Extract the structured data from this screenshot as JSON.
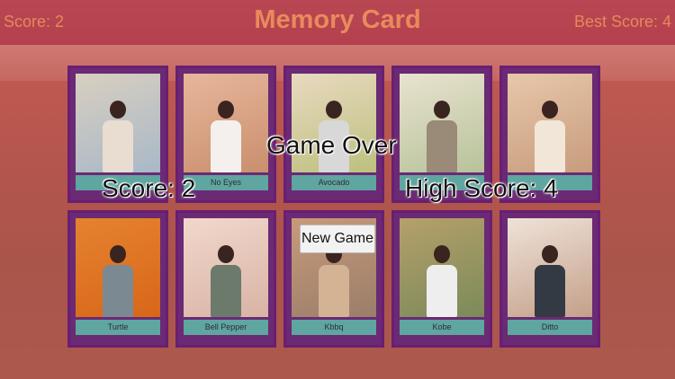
{
  "header": {
    "score_label": "Score: 2",
    "title": "Memory Card",
    "best_score_label": "Best Score: 4"
  },
  "cards": [
    {
      "label": "",
      "photo_bg": "#a9b8c8",
      "photo_bg2": "#d8cfc0",
      "body": "#e8ddd0"
    },
    {
      "label": "No Eyes",
      "photo_bg": "#c98f6e",
      "photo_bg2": "#e8b69b",
      "body": "#f3f0ee"
    },
    {
      "label": "Avocado",
      "photo_bg": "#bcc07e",
      "photo_bg2": "#e9d9c0",
      "body": "#d8d8d8"
    },
    {
      "label": "",
      "photo_bg": "#b7c29a",
      "photo_bg2": "#e9e3cf",
      "body": "#9a8a78"
    },
    {
      "label": "",
      "photo_bg": "#c79c7d",
      "photo_bg2": "#e8c7aa",
      "body": "#f1e6d8"
    },
    {
      "label": "Turtle",
      "photo_bg": "#d8661a",
      "photo_bg2": "#e5832f",
      "body": "#7b8a92"
    },
    {
      "label": "Bell Pepper",
      "photo_bg": "#d9b3a5",
      "photo_bg2": "#f1d8cc",
      "body": "#6b7a6a"
    },
    {
      "label": "Kbbq",
      "photo_bg": "#9a7e6a",
      "photo_bg2": "#c89a7a",
      "body": "#d4b394"
    },
    {
      "label": "Kobe",
      "photo_bg": "#7b8a5a",
      "photo_bg2": "#b5a06a",
      "body": "#eeeeee"
    },
    {
      "label": "Ditto",
      "photo_bg": "#c4a08a",
      "photo_bg2": "#efe2d8",
      "body": "#333a44"
    }
  ],
  "overlay": {
    "game_over": "Game Over",
    "score": "Score: 2",
    "high_score": "High Score: 4",
    "new_game_button": "New Game"
  }
}
